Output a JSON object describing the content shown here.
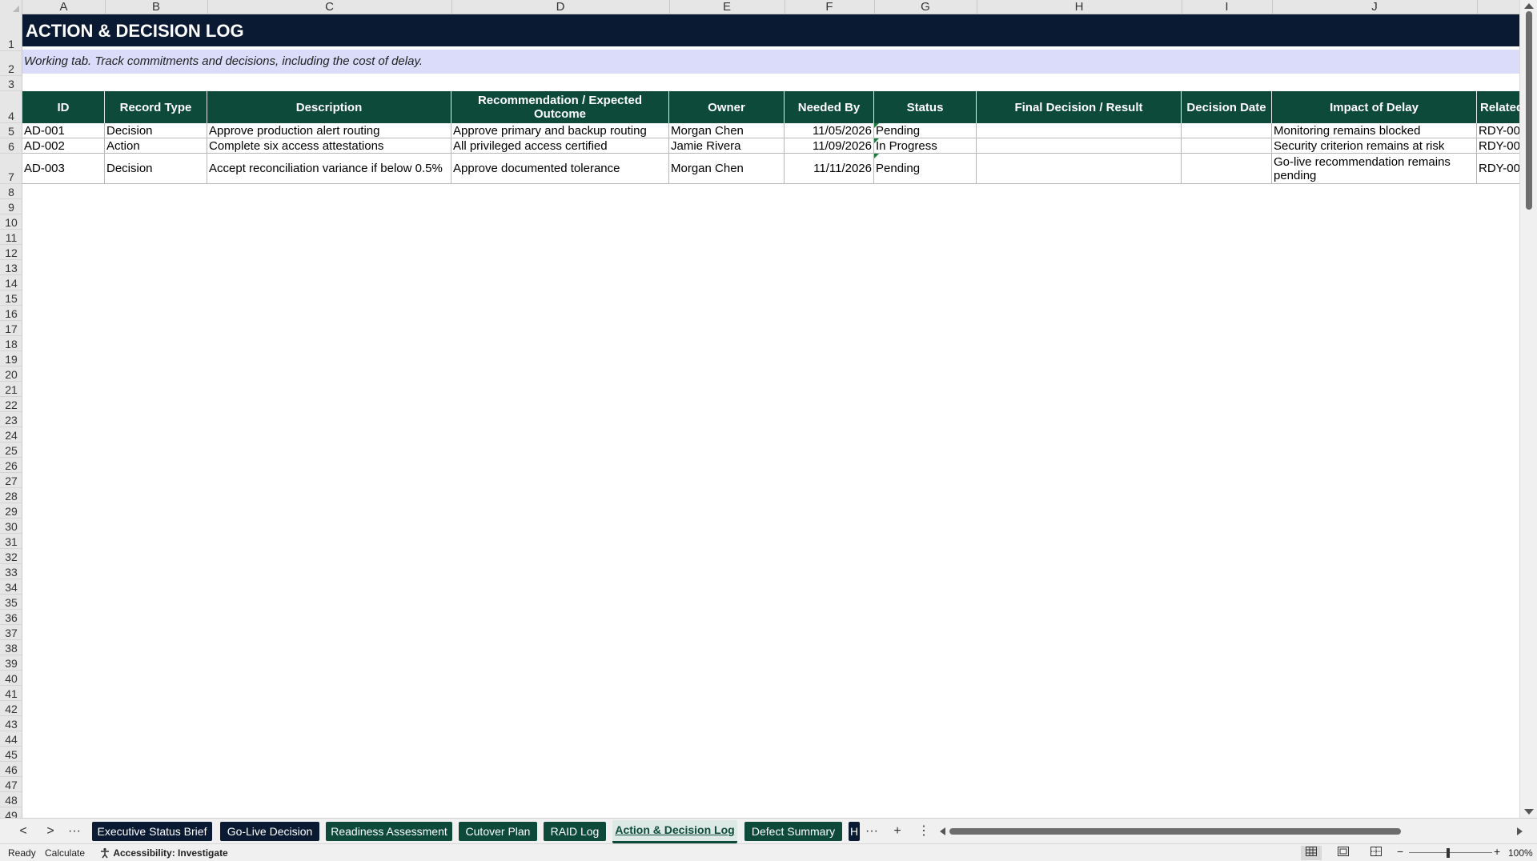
{
  "columns": [
    "A",
    "B",
    "C",
    "D",
    "E",
    "F",
    "G",
    "H",
    "I",
    "J"
  ],
  "rows": [
    "1",
    "2",
    "3",
    "4",
    "5",
    "6",
    "7",
    "8",
    "9",
    "10",
    "11",
    "12",
    "13",
    "14",
    "15",
    "16",
    "17",
    "18",
    "19",
    "20",
    "21",
    "22",
    "23",
    "24",
    "25",
    "26",
    "27",
    "28",
    "29",
    "30",
    "31",
    "32",
    "33",
    "34",
    "35",
    "36",
    "37",
    "38",
    "39",
    "40",
    "41",
    "42",
    "43",
    "44",
    "45",
    "46",
    "47",
    "48",
    "49"
  ],
  "sheet": {
    "title": "ACTION & DECISION LOG",
    "subtitle": "Working tab. Track commitments and decisions, including the cost of delay."
  },
  "table": {
    "headers": [
      "ID",
      "Record Type",
      "Description",
      "Recommendation / Expected Outcome",
      "Owner",
      "Needed By",
      "Status",
      "Final Decision / Result",
      "Decision Date",
      "Impact of Delay",
      "Related"
    ],
    "rows": [
      [
        "AD-001",
        "Decision",
        "Approve production alert routing",
        "Approve primary and backup routing",
        "Morgan Chen",
        "11/05/2026",
        "Pending",
        "",
        "",
        "Monitoring remains blocked",
        "RDY-00"
      ],
      [
        "AD-002",
        "Action",
        "Complete six access attestations",
        "All privileged access certified",
        "Jamie Rivera",
        "11/09/2026",
        "In Progress",
        "",
        "",
        "Security criterion remains at risk",
        "RDY-00"
      ],
      [
        "AD-003",
        "Decision",
        "Accept reconciliation variance if below 0.5%",
        "Approve documented tolerance",
        "Morgan Chen",
        "11/11/2026",
        "Pending",
        "",
        "",
        "Go-live recommendation remains pending",
        "RDY-00"
      ]
    ]
  },
  "tabs": [
    {
      "label": "Executive Status Brief",
      "style": "navy"
    },
    {
      "label": "Go-Live Decision",
      "style": "navy"
    },
    {
      "label": "Readiness Assessment",
      "style": "green"
    },
    {
      "label": "Cutover Plan",
      "style": "green"
    },
    {
      "label": "RAID Log",
      "style": "green"
    },
    {
      "label": "Action & Decision Log",
      "style": "active"
    },
    {
      "label": "Defect Summary",
      "style": "green"
    },
    {
      "label": "H",
      "style": "navy"
    }
  ],
  "tabnav": {
    "prev": "<",
    "next": ">",
    "more": "···",
    "more_right": "···",
    "add": "+",
    "options": "⋮"
  },
  "status": {
    "ready": "Ready",
    "calculate": "Calculate",
    "accessibility": "Accessibility: Investigate",
    "zoom_minus": "−",
    "zoom_plus": "+",
    "zoom": "100%"
  },
  "icons": {
    "accessibility": "accessibility-icon",
    "normal_view": "normal-view-icon",
    "page_layout": "page-layout-icon",
    "page_break": "page-break-preview-icon"
  }
}
